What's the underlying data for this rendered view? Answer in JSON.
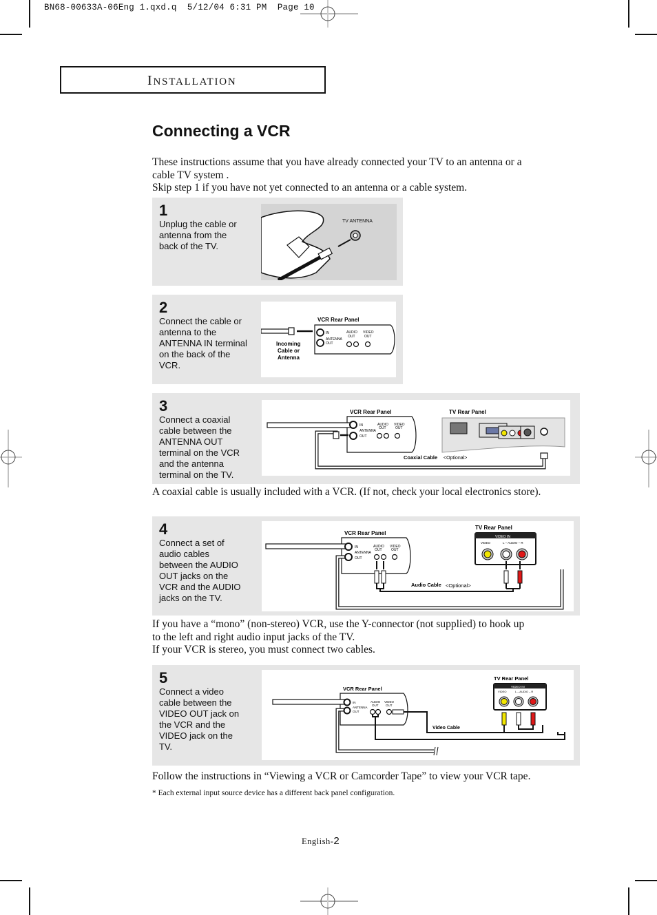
{
  "print_slug": "BN68-00633A-06Eng 1.qxd.q  5/12/04 6:31 PM  Page 10",
  "section": {
    "first_letter": "I",
    "rest": "NSTALLATION"
  },
  "title": "Connecting a VCR",
  "intro": [
    "These instructions assume that you have already connected your TV to an antenna or a",
    "cable TV system .",
    "Skip step 1 if you have not yet connected to an antenna or a cable system."
  ],
  "steps": [
    {
      "number": "1",
      "lines": [
        "Unplug the cable or",
        "antenna from the",
        "back of the TV."
      ],
      "diagram": {
        "labels": {
          "tv_antenna": "TV ANTENNA"
        }
      }
    },
    {
      "number": "2",
      "lines": [
        "Connect the cable or",
        "antenna to the",
        "ANTENNA IN terminal",
        "on the back of the",
        "VCR."
      ],
      "diagram": {
        "labels": {
          "vcr_panel": "VCR  Rear  Panel",
          "incoming_1": "Incoming",
          "incoming_2": "Cable  or",
          "incoming_3": "Antenna",
          "in": "IN",
          "antenna": "ANTENNA",
          "out": "OUT",
          "audio_out": "AUDIO",
          "audio_out2": "OUT",
          "video_out": "VIDEO",
          "video_out2": "OUT"
        }
      }
    },
    {
      "number": "3",
      "lines": [
        "Connect a coaxial",
        "cable between the",
        "ANTENNA OUT",
        "terminal on the VCR",
        "and the antenna",
        "terminal on the TV."
      ],
      "diagram": {
        "labels": {
          "vcr_panel": "VCR  Rear  Panel",
          "tv_panel": "TV  Rear  Panel",
          "cable": "Coaxial  Cable",
          "optional": "<Optional>",
          "in": "IN",
          "antenna": "ANTENNA",
          "out": "OUT",
          "audio_out": "AUDIO",
          "audio_out2": "OUT",
          "video_out": "VIDEO",
          "video_out2": "OUT"
        }
      }
    },
    {
      "number": "4",
      "lines": [
        "Connect a set of",
        "audio cables",
        "between the AUDIO",
        "OUT jacks on the",
        "VCR and the AUDIO",
        "jacks on the TV."
      ],
      "diagram": {
        "labels": {
          "vcr_panel": "VCR  Rear  Panel",
          "tv_panel": "TV  Rear  Panel",
          "video_in": "VIDEO IN",
          "video": "VIDEO",
          "audio_lr": "L – AUDIO – R",
          "cable": "Audio Cable",
          "optional": "<Optional>",
          "in": "IN",
          "antenna": "ANTENNA",
          "out": "OUT",
          "audio_out": "AUDIO",
          "audio_out2": "OUT",
          "video_out": "VIDEO",
          "video_out2": "OUT"
        }
      }
    },
    {
      "number": "5",
      "lines": [
        "Connect a video",
        "cable between the",
        "VIDEO OUT jack on",
        "the VCR and the",
        "VIDEO jack on the",
        "TV."
      ],
      "diagram": {
        "labels": {
          "vcr_panel": "VCR  Rear  Panel",
          "tv_panel": "TV  Rear  Panel",
          "video_in": "VIDEO IN",
          "video": "VIDEO",
          "audio_lr": "L – AUDIO – R",
          "cable": "Video  Cable",
          "in": "IN",
          "antenna": "ANTENNA",
          "out": "OUT",
          "audio_out": "AUDIO",
          "audio_out2": "OUT",
          "video_out": "VIDEO",
          "video_out2": "OUT"
        }
      }
    }
  ],
  "note_coaxial": "A coaxial cable is usually included with a VCR. (If not, check your local electronics store).",
  "note_mono": [
    "If you have a “mono” (non-stereo) VCR, use the Y-connector (not supplied) to hook up",
    "to the left and right audio input jacks of the TV.",
    "If your VCR is stereo, you must connect two cables."
  ],
  "follow": "Follow the instructions in “Viewing a VCR or Camcorder Tape” to view your VCR tape.",
  "footnote": "* Each external input source device has a different back panel configuration.",
  "page": {
    "prefix": "English-",
    "number": "2"
  },
  "colors": {
    "panel_bg": "#e6e6e6",
    "jack_yellow": "#f2e600",
    "jack_red": "#e01818",
    "ink": "#111111"
  }
}
